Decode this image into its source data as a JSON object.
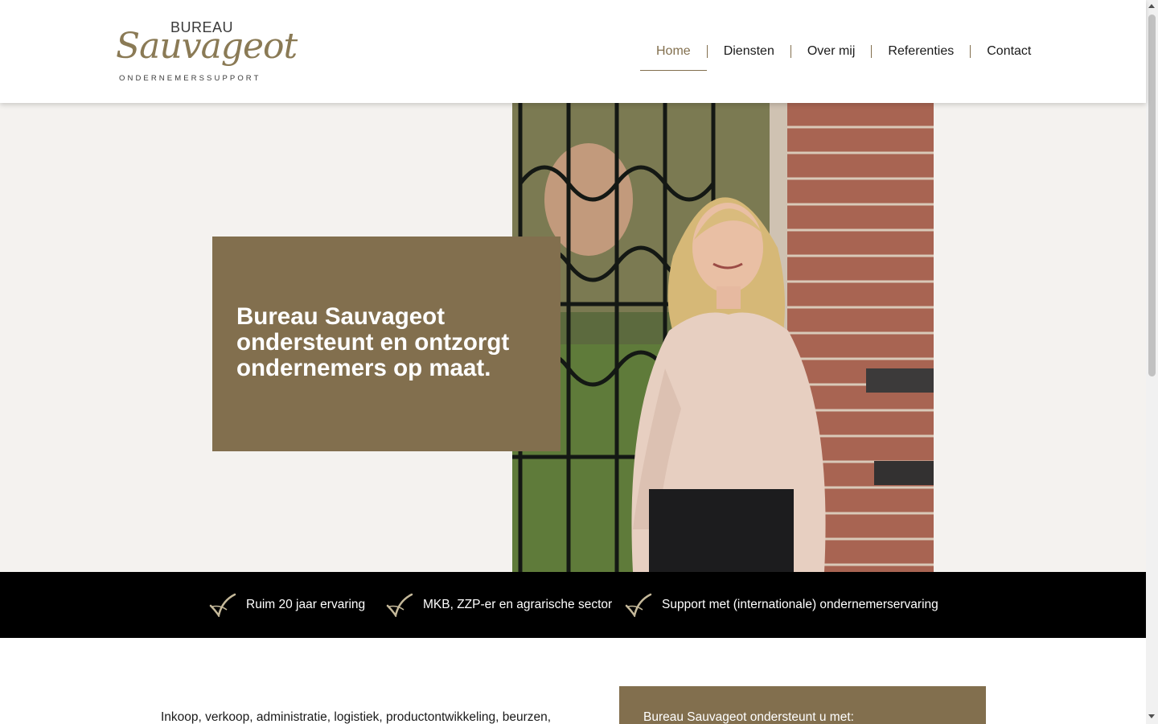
{
  "logo": {
    "top_word": "BUREAU",
    "script_word": "Sauvageot",
    "tagline": "ONDERNEMERSSUPPORT"
  },
  "nav": {
    "items": [
      {
        "label": "Home",
        "active": true
      },
      {
        "label": "Diensten",
        "active": false
      },
      {
        "label": "Over mij",
        "active": false
      },
      {
        "label": "Referenties",
        "active": false
      },
      {
        "label": "Contact",
        "active": false
      }
    ]
  },
  "hero": {
    "title": "Bureau Sauvageot ondersteunt en ontzorgt ondernemers op maat."
  },
  "features": [
    {
      "icon": "checkmark-icon",
      "text": "Ruim 20 jaar ervaring"
    },
    {
      "icon": "checkmark-icon",
      "text": "MKB, ZZP-er en agrarische sector"
    },
    {
      "icon": "checkmark-icon",
      "text": "Support met (internationale) ondernemerservaring"
    }
  ],
  "content": {
    "intro": "Inkoop, verkoop, administratie, logistiek, productontwikkeling, beurzen,",
    "card_heading": "Bureau Sauvageot ondersteunt u met:"
  },
  "colors": {
    "accent": "#826f4e",
    "hero_bg": "#f4f2ef",
    "feature_bar": "#000000"
  }
}
